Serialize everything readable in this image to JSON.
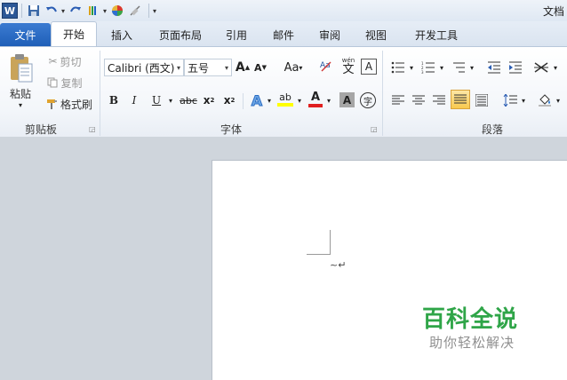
{
  "qat": {
    "logo": "W",
    "title": "文档"
  },
  "tabs": {
    "file": "文件",
    "items": [
      "开始",
      "插入",
      "页面布局",
      "引用",
      "邮件",
      "审阅",
      "视图",
      "开发工具"
    ]
  },
  "clipboard": {
    "paste": "粘贴",
    "cut": "剪切",
    "copy": "复制",
    "format_painter": "格式刷",
    "label": "剪贴板"
  },
  "font": {
    "font_name": "Calibri (西文)",
    "font_size": "五号",
    "aa": "Aa",
    "bold": "B",
    "italic": "I",
    "underline": "U",
    "strike": "abc",
    "subscript": "x",
    "superscript": "x",
    "sub_mark": "2",
    "sup_mark": "2",
    "grow": "A",
    "shrink": "A",
    "text_effect": "A",
    "highlight": "ab",
    "font_color": "A",
    "char_shade": "A",
    "enclose": "字",
    "phonetic": "wén",
    "phonetic_char": "文",
    "border_char": "A",
    "clear_format": "A",
    "label": "字体"
  },
  "paragraph": {
    "label": "段落"
  },
  "document": {
    "cursor_marks": "~↵"
  },
  "watermark": {
    "title": "百科全说",
    "subtitle": "助你轻松解决"
  },
  "colors": {
    "file_tab": "#1f5fb8",
    "highlight": "#ffff00",
    "font_color_bar": "#e02020",
    "watermark_green": "#2fa548"
  }
}
